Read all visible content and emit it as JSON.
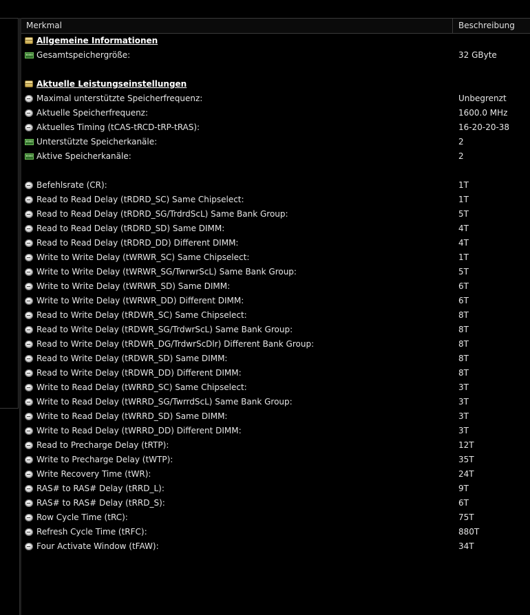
{
  "columns": {
    "merkmal": "Merkmal",
    "beschreibung": "Beschreibung"
  },
  "rows": [
    {
      "type": "section",
      "icon": "database-icon",
      "label": "Allgemeine Informationen",
      "value": ""
    },
    {
      "type": "item",
      "icon": "ram-icon",
      "label": "Gesamtspeichergröße:",
      "value": "32 GByte"
    },
    {
      "type": "blank",
      "icon": "",
      "label": "",
      "value": ""
    },
    {
      "type": "section",
      "icon": "database-icon",
      "label": "Aktuelle Leistungseinstellungen",
      "value": ""
    },
    {
      "type": "item",
      "icon": "circle-icon",
      "label": "Maximal unterstützte Speicherfrequenz:",
      "value": "Unbegrenzt"
    },
    {
      "type": "item",
      "icon": "circle-icon",
      "label": "Aktuelle Speicherfrequenz:",
      "value": "1600.0 MHz"
    },
    {
      "type": "item",
      "icon": "circle-icon",
      "label": "Aktuelles Timing (tCAS-tRCD-tRP-tRAS):",
      "value": "16-20-20-38"
    },
    {
      "type": "item",
      "icon": "ram-icon",
      "label": "Unterstützte Speicherkanäle:",
      "value": "2"
    },
    {
      "type": "item",
      "icon": "ram-icon",
      "label": "Aktive Speicherkanäle:",
      "value": "2"
    },
    {
      "type": "blank",
      "icon": "",
      "label": "",
      "value": ""
    },
    {
      "type": "item",
      "icon": "circle-icon",
      "label": "Befehlsrate (CR):",
      "value": "1T"
    },
    {
      "type": "item",
      "icon": "circle-icon",
      "label": "Read to Read Delay (tRDRD_SC) Same Chipselect:",
      "value": "1T"
    },
    {
      "type": "item",
      "icon": "circle-icon",
      "label": "Read to Read Delay (tRDRD_SG/TrdrdScL) Same Bank Group:",
      "value": "5T"
    },
    {
      "type": "item",
      "icon": "circle-icon",
      "label": "Read to Read Delay (tRDRD_SD) Same DIMM:",
      "value": "4T"
    },
    {
      "type": "item",
      "icon": "circle-icon",
      "label": "Read to Read Delay (tRDRD_DD) Different DIMM:",
      "value": "4T"
    },
    {
      "type": "item",
      "icon": "circle-icon",
      "label": "Write to Write Delay (tWRWR_SC) Same Chipselect:",
      "value": "1T"
    },
    {
      "type": "item",
      "icon": "circle-icon",
      "label": "Write to Write Delay (tWRWR_SG/TwrwrScL) Same Bank Group:",
      "value": "5T"
    },
    {
      "type": "item",
      "icon": "circle-icon",
      "label": "Write to Write Delay (tWRWR_SD) Same DIMM:",
      "value": "6T"
    },
    {
      "type": "item",
      "icon": "circle-icon",
      "label": "Write to Write Delay (tWRWR_DD) Different DIMM:",
      "value": "6T"
    },
    {
      "type": "item",
      "icon": "circle-icon",
      "label": "Read to Write Delay (tRDWR_SC) Same Chipselect:",
      "value": "8T"
    },
    {
      "type": "item",
      "icon": "circle-icon",
      "label": "Read to Write Delay (tRDWR_SG/TrdwrScL) Same Bank Group:",
      "value": "8T"
    },
    {
      "type": "item",
      "icon": "circle-icon",
      "label": "Read to Write Delay (tRDWR_DG/TrdwrScDlr) Different Bank Group:",
      "value": "8T"
    },
    {
      "type": "item",
      "icon": "circle-icon",
      "label": "Read to Write Delay (tRDWR_SD) Same DIMM:",
      "value": "8T"
    },
    {
      "type": "item",
      "icon": "circle-icon",
      "label": "Read to Write Delay (tRDWR_DD) Different DIMM:",
      "value": "8T"
    },
    {
      "type": "item",
      "icon": "circle-icon",
      "label": "Write to Read Delay (tWRRD_SC) Same Chipselect:",
      "value": "3T"
    },
    {
      "type": "item",
      "icon": "circle-icon",
      "label": "Write to Read Delay (tWRRD_SG/TwrrdScL) Same Bank Group:",
      "value": "3T"
    },
    {
      "type": "item",
      "icon": "circle-icon",
      "label": "Write to Read Delay (tWRRD_SD) Same DIMM:",
      "value": "3T"
    },
    {
      "type": "item",
      "icon": "circle-icon",
      "label": "Write to Read Delay (tWRRD_DD) Different DIMM:",
      "value": "3T"
    },
    {
      "type": "item",
      "icon": "circle-icon",
      "label": "Read to Precharge Delay (tRTP):",
      "value": "12T"
    },
    {
      "type": "item",
      "icon": "circle-icon",
      "label": "Write to Precharge Delay (tWTP):",
      "value": "35T"
    },
    {
      "type": "item",
      "icon": "circle-icon",
      "label": "Write Recovery Time (tWR):",
      "value": "24T"
    },
    {
      "type": "item",
      "icon": "circle-icon",
      "label": "RAS# to RAS# Delay (tRRD_L):",
      "value": "9T"
    },
    {
      "type": "item",
      "icon": "circle-icon",
      "label": "RAS# to RAS# Delay (tRRD_S):",
      "value": "6T"
    },
    {
      "type": "item",
      "icon": "circle-icon",
      "label": "Row Cycle Time (tRC):",
      "value": "75T"
    },
    {
      "type": "item",
      "icon": "circle-icon",
      "label": "Refresh Cycle Time (tRFC):",
      "value": "880T"
    },
    {
      "type": "item",
      "icon": "circle-icon",
      "label": "Four Activate Window (tFAW):",
      "value": "34T"
    }
  ]
}
